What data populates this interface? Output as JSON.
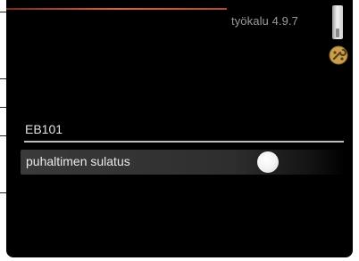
{
  "header": {
    "title": "työkalu 4.9.7"
  },
  "section": {
    "label": "EB101"
  },
  "settings": {
    "items": [
      {
        "label": "puhaltimen sulatus",
        "toggle_state": "on"
      }
    ]
  },
  "colors": {
    "background": "#000000",
    "accent_line": "#e0603a",
    "text_primary": "#eaeaea",
    "text_title": "#9a9a9a"
  },
  "icons": {
    "status": "thermometer-icon",
    "tool": "wrench-icon"
  }
}
